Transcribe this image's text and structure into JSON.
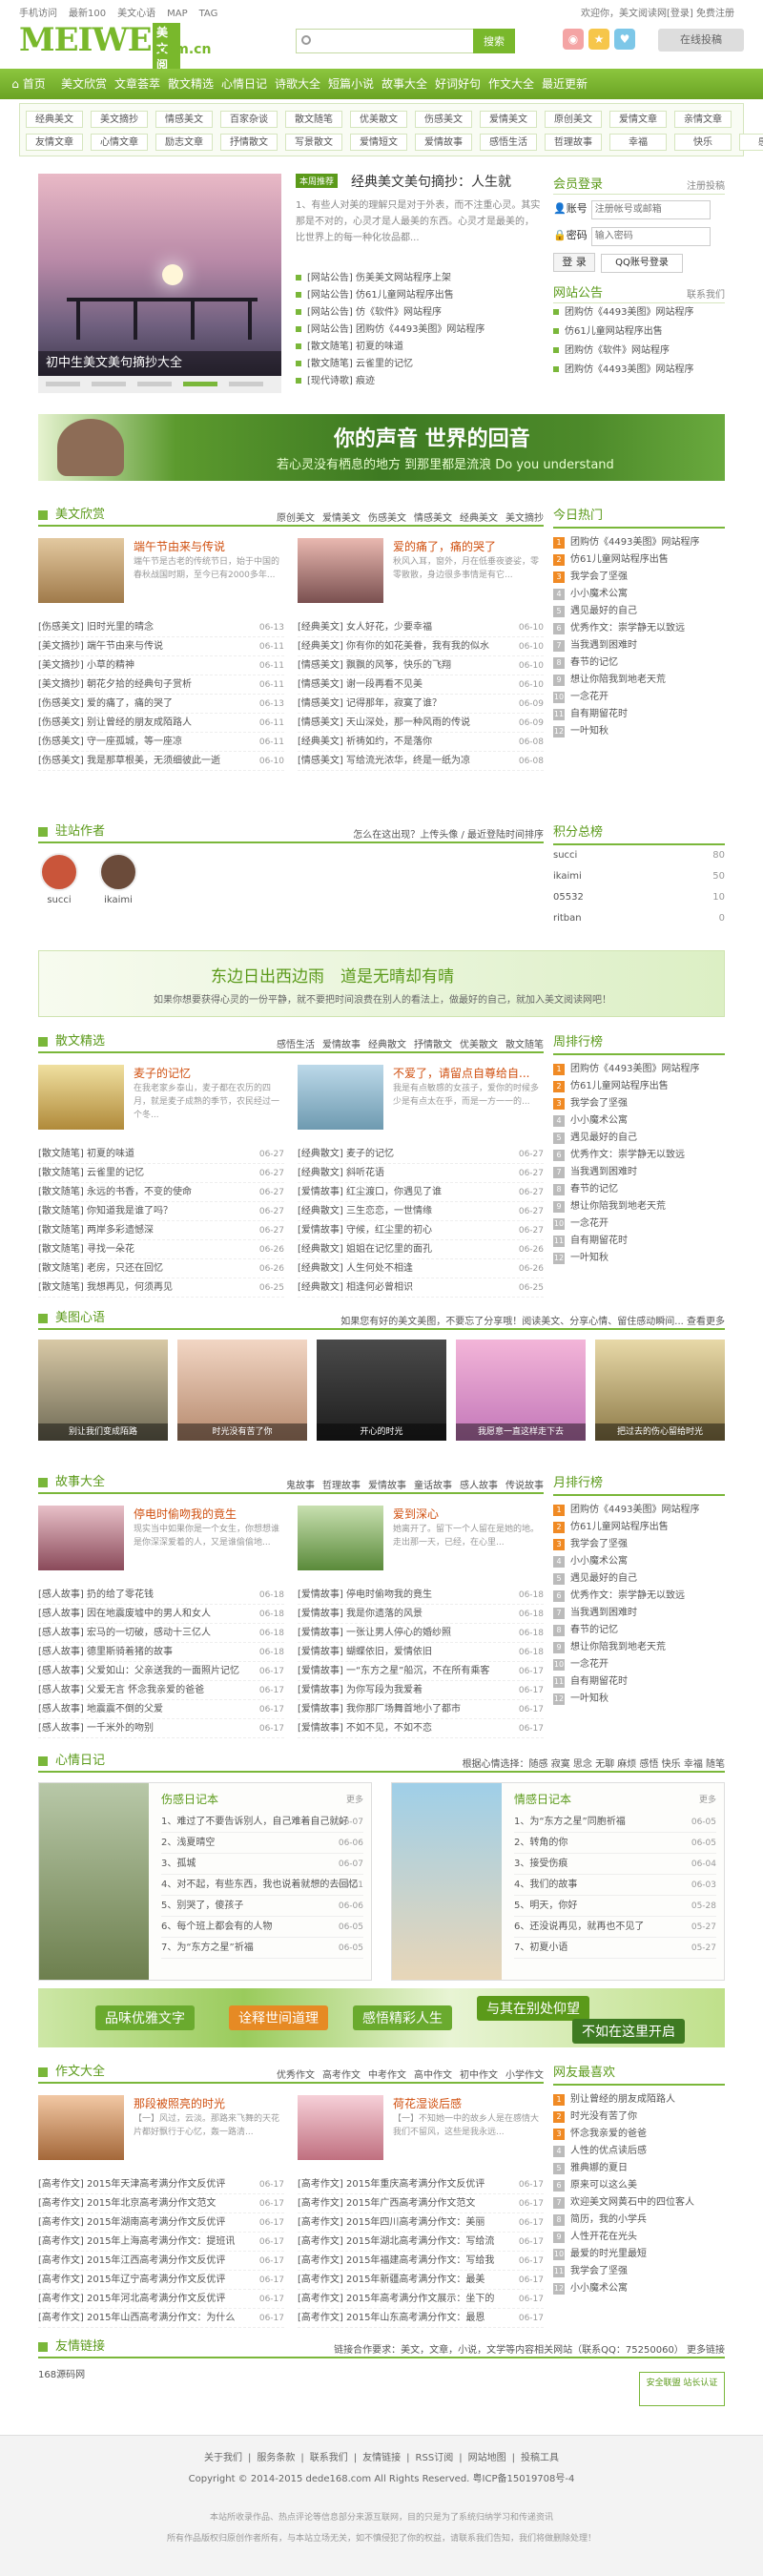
{
  "top": {
    "links": [
      "手机访问",
      "最新100",
      "美文心语",
      "MAP",
      "TAG"
    ],
    "welcome": "欢迎你，美文阅读网[登录] 免费注册"
  },
  "logo": {
    "main": "MEIWEN",
    "badge": "美文阅读",
    "domain": ".com.cn"
  },
  "search": {
    "placeholder": "",
    "button": "搜索"
  },
  "header": {
    "right_button": "在线投稿"
  },
  "nav": [
    "首页",
    "美文欣赏",
    "文章荟萃",
    "散文精选",
    "心情日记",
    "诗歌大全",
    "短篇小说",
    "故事大全",
    "好词好句",
    "作文大全",
    "最近更新"
  ],
  "subnav": [
    [
      "经典美文",
      "美文摘抄",
      "情感美文",
      "百家杂谈",
      "散文随笔",
      "优美散文",
      "伤感美文",
      "爱情美文",
      "原创美文",
      "爱情文章",
      "亲情文章"
    ],
    [
      "友情文章",
      "心情文章",
      "励志文章",
      "抒情散文",
      "写景散文",
      "爱情短文",
      "爱情故事",
      "感悟生活",
      "哲理故事",
      "幸福",
      "快乐",
      "感伤"
    ]
  ],
  "slide": {
    "caption": "初中生美文美句摘抄大全"
  },
  "headline": {
    "tag": "本周推荐",
    "title": "经典美文美句摘抄：人生就",
    "desc": "1、有些人对美的理解只是对于外表，而不注重心灵。其实那是不对的，心灵才是人最美的东西。心灵才是最美的，比世界上的每一种化妆品都...",
    "list": [
      "[网站公告] 伤美美文网站程序上架",
      "[网站公告] 仿61儿童网站程序出售",
      "[网站公告] 仿《软件》网站程序",
      "[网站公告] 团购仿《4493美图》网站程序",
      "[散文随笔] 初夏的味道",
      "[散文随笔] 云雀里的记忆",
      "[现代诗歌] 痕迹"
    ]
  },
  "login": {
    "title": "会员登录",
    "reg": "注册投稿",
    "user_label": "账号",
    "user_ph": "注册帐号或邮箱",
    "pwd_label": "密码",
    "pwd_ph": "输入密码",
    "btn": "登 录",
    "qq": "QQ账号登录"
  },
  "notice": {
    "title": "网站公告",
    "more": "联系我们",
    "list": [
      "团购仿《4493美图》网站程序",
      "仿61儿童网站程序出售",
      "团购仿《软件》网站程序",
      "团购仿《4493美图》网站程序"
    ]
  },
  "banner": {
    "t1": "你的声音 世界的回音",
    "t2": "若心灵没有栖息的地方 到那里都是流浪 Do you understand"
  },
  "sec1": {
    "title": "美文欣赏",
    "tabs": [
      "原创美文",
      "爱情美文",
      "伤感美文",
      "情感美文",
      "经典美文",
      "美文摘抄"
    ],
    "f1": {
      "title": "端午节由来与传说",
      "desc": "端午节是古老的传统节日，始于中国的春秋战国时期，至今已有2000多年..."
    },
    "f2": {
      "title": "爱的痛了，痛的哭了",
      "desc": "秋风入耳，窗外，月在低垂夜婆娑，零零散散，身边很多事情是有它..."
    },
    "l1": [
      [
        "[伤感美文] 旧时光里的晴念",
        "06-13"
      ],
      [
        "[美文摘抄] 端午节由来与传说",
        "06-11"
      ],
      [
        "[美文摘抄] 小草的精神",
        "06-11"
      ],
      [
        "[美文摘抄] 朝花夕拾的经典句子赏析",
        "06-11"
      ],
      [
        "[伤感美文] 爱的痛了，痛的哭了",
        "06-13"
      ],
      [
        "[伤感美文] 别让曾经的朋友成陌路人",
        "06-11"
      ],
      [
        "[伤感美文] 守一座孤城，等一座凉",
        "06-11"
      ],
      [
        "[伤感美文] 我是那草根美，无须细彼此一逝",
        "06-10"
      ]
    ],
    "l2": [
      [
        "[经典美文] 女人好花，少要幸福",
        "06-10"
      ],
      [
        "[经典美文] 你有你的如花美眷，我有我的似水",
        "06-10"
      ],
      [
        "[情感美文] 飘飘的风筝，快乐的飞翔",
        "06-10"
      ],
      [
        "[情感美文] 谢一段再看不见美",
        "06-10"
      ],
      [
        "[情感美文] 记得那年，寂寞了谁？",
        "06-09"
      ],
      [
        "[情感美文] 天山深处，那一种风雨的传说",
        "06-09"
      ],
      [
        "[经典美文] 祈祷如约，不是落你",
        "06-08"
      ],
      [
        "[情感美文] 写给流光浓华，终是一纸为凉",
        "06-08"
      ]
    ]
  },
  "hot": {
    "title": "今日热门",
    "list": [
      "团购仿《4493美图》网站程序",
      "仿61儿童网站程序出售",
      "我学会了坚强",
      "小小魔术公寓",
      "遇见最好的自己",
      "优秀作文：崇学静无以致远",
      "当我遇到困难时",
      "春节的记忆",
      "想让你陪我到地老天荒",
      "一念花开",
      "自有期留花时",
      "一叶知秋"
    ]
  },
  "authors": {
    "title": "驻站作者",
    "tip": "怎么在这出现？上传头像 / 最近登陆时间排序",
    "list": [
      "succi",
      "ikaimi"
    ]
  },
  "score": {
    "title": "积分总榜",
    "list": [
      [
        "succi",
        "80"
      ],
      [
        "ikaimi",
        "50"
      ],
      [
        "05532",
        "10"
      ],
      [
        "ritban",
        "0"
      ]
    ]
  },
  "banner2": {
    "t1": "东边日出西边雨　道是无晴却有晴",
    "t2": "如果你想要获得心灵的一份平静，就不要把时间浪费在别人的看法上，做最好的自己，就加入美文阅读网吧！"
  },
  "sec2": {
    "title": "散文精选",
    "tabs": [
      "感悟生活",
      "爱情故事",
      "经典散文",
      "抒情散文",
      "优美散文",
      "散文随笔"
    ],
    "f1": {
      "title": "麦子的记忆",
      "desc": "在我老家乡泰山，麦子都在农历的四月，就是麦子成熟的季节，农民经过一个冬..."
    },
    "f2": {
      "title": "不爱了，请留点自尊给自...",
      "desc": "我是有点敏感的女孩子，爱你的时候多少是有点太在乎，而是一方一一的..."
    },
    "l1": [
      [
        "[散文随笔] 初夏的味道",
        "06-27"
      ],
      [
        "[散文随笔] 云雀里的记忆",
        "06-27"
      ],
      [
        "[散文随笔] 永远的书香，不变的使命",
        "06-27"
      ],
      [
        "[散文随笔] 你知道我是谁了吗？",
        "06-27"
      ],
      [
        "[散文随笔] 两岸多彩遗憾深",
        "06-27"
      ],
      [
        "[散文随笔] 寻找一朵花",
        "06-26"
      ],
      [
        "[散文随笔] 老房，只还在回忆",
        "06-26"
      ],
      [
        "[散文随笔] 我想再见，何须再见",
        "06-25"
      ]
    ],
    "l2": [
      [
        "[经典散文] 麦子的记忆",
        "06-27"
      ],
      [
        "[经典散文] 斜听花语",
        "06-27"
      ],
      [
        "[爱情故事] 红尘渡口，你遇见了谁",
        "06-27"
      ],
      [
        "[经典散文] 三生恋恋，一世情缘",
        "06-27"
      ],
      [
        "[爱情故事] 守候，红尘里的初心",
        "06-27"
      ],
      [
        "[经典散文] 姐姐在记忆里的面孔",
        "06-26"
      ],
      [
        "[经典散文] 人生何处不相逢",
        "06-26"
      ],
      [
        "[经典散文] 相逢何必曾相识",
        "06-25"
      ]
    ]
  },
  "week": {
    "title": "周排行榜",
    "list": [
      "团购仿《4493美图》网站程序",
      "仿61儿童网站程序出售",
      "我学会了坚强",
      "小小魔术公寓",
      "遇见最好的自己",
      "优秀作文：崇学静无以致远",
      "当我遇到困难时",
      "春节的记忆",
      "想让你陪我到地老天荒",
      "一念花开",
      "自有期留花时",
      "一叶知秋"
    ]
  },
  "pics": {
    "title": "美图心语",
    "tip": "如果您有好的美文美图，不要忘了分享哦！阅读美文、分享心情、留住感动瞬间... 查看更多",
    "list": [
      "别让我们变成陌路",
      "时光没有苦了你",
      "开心的时光",
      "我愿意一直这样走下去",
      "把过去的伤心留给时光"
    ]
  },
  "sec3": {
    "title": "故事大全",
    "tabs": [
      "鬼故事",
      "哲理故事",
      "爱情故事",
      "童话故事",
      "感人故事",
      "传说故事"
    ],
    "f1": {
      "title": "停电时偷吻我的竟生",
      "desc": "现实当中如果你是一个女生，你想想谁是你深深爱着的人，又是谁偷偷地..."
    },
    "f2": {
      "title": "爱到深心",
      "desc": "她离开了。留下一个人留在是她的地。 走出那一天，已经，在心里..."
    },
    "l1": [
      [
        "[感人故事] 扔的给了零花钱",
        "06-18"
      ],
      [
        "[感人故事] 因在地震废墟中的男人和女人",
        "06-18"
      ],
      [
        "[感人故事] 宏马的一切破，感动十三亿人",
        "06-18"
      ],
      [
        "[感人故事] 德里斯骑着猪的故事",
        "06-18"
      ],
      [
        "[感人故事] 父爱如山：父亲送我的一面照片记忆",
        "06-17"
      ],
      [
        "[感人故事] 父爱无言 怀念我亲爱的爸爸",
        "06-17"
      ],
      [
        "[感人故事] 地震震不倒的父爱",
        "06-17"
      ],
      [
        "[感人故事] 一千米外的吻别",
        "06-17"
      ]
    ],
    "l2": [
      [
        "[爱情故事] 停电时偷吻我的竟生",
        "06-18"
      ],
      [
        "[爱情故事] 我是你遗落的风景",
        "06-18"
      ],
      [
        "[爱情故事] 一张让男人停心的婚纱照",
        "06-18"
      ],
      [
        "[爱情故事] 蝴蝶依旧，爱情依旧",
        "06-18"
      ],
      [
        "[爱情故事] 一“东方之星”船沉，不在所有乘客",
        "06-17"
      ],
      [
        "[爱情故事] 为你写段为我爱着",
        "06-17"
      ],
      [
        "[爱情故事] 我你那厂场舞首地小了都市",
        "06-17"
      ],
      [
        "[爱情故事] 不如不见，不如不恋",
        "06-17"
      ]
    ]
  },
  "month": {
    "title": "月排行榜",
    "list": [
      "团购仿《4493美图》网站程序",
      "仿61儿童网站程序出售",
      "我学会了坚强",
      "小小魔术公寓",
      "遇见最好的自己",
      "优秀作文：崇学静无以致远",
      "当我遇到困难时",
      "春节的记忆",
      "想让你陪我到地老天荒",
      "一念花开",
      "自有期留花时",
      "一叶知秋"
    ]
  },
  "diary": {
    "title": "心情日记",
    "tabs": "根据心情选择：随感 寂寞 思念 无聊 麻烦 感悟 快乐 幸福 随笔",
    "a": {
      "title": "伤感日记本",
      "more": "更多",
      "list": [
        [
          "1、难过了不要告诉别人，自己难着自己就好",
          "06-07"
        ],
        [
          "2、浅夏晴空",
          "06-06"
        ],
        [
          "3、孤城",
          "06-07"
        ],
        [
          "4、对不起，有些东西，我也说着就想的去回忆",
          "06-01"
        ],
        [
          "5、别哭了，傻孩子",
          "06-06"
        ],
        [
          "6、每个班上都会有的人物",
          "06-05"
        ],
        [
          "7、为“东方之星”祈福",
          "06-05"
        ]
      ]
    },
    "b": {
      "title": "情感日记本",
      "more": "更多",
      "list": [
        [
          "1、为“东方之星”同胞祈福",
          "06-05"
        ],
        [
          "2、转角的你",
          "06-05"
        ],
        [
          "3、接受伤痕",
          "06-04"
        ],
        [
          "4、我们的故事",
          "06-03"
        ],
        [
          "5、明天，你好",
          "05-28"
        ],
        [
          "6、还没说再见，就再也不见了",
          "05-27"
        ],
        [
          "7、初夏小语",
          "05-27"
        ]
      ]
    }
  },
  "banner3": {
    "a": "品味优雅文字",
    "b": "诠释世间道理",
    "c": "感悟精彩人生",
    "d": "与其在别处仰望",
    "e": "不如在这里开启"
  },
  "sec4": {
    "title": "作文大全",
    "tabs": [
      "优秀作文",
      "高考作文",
      "中考作文",
      "高中作文",
      "初中作文",
      "小学作文"
    ],
    "f1": {
      "title": "那段被照亮的时光",
      "desc": "【一】风过，云淡。那路来飞舞的天花片都好飘行于心忆，轰一路清..."
    },
    "f2": {
      "title": "荷花湿谈后感",
      "desc": "【一】不知她一中的故乡人是在感情大我们不留风，这些是我永远..."
    },
    "l1": [
      [
        "[高考作文] 2015年天津高考满分作文反优评",
        "06-17"
      ],
      [
        "[高考作文] 2015年北京高考满分作文范文",
        "06-17"
      ],
      [
        "[高考作文] 2015年湖南高考满分作文反优评",
        "06-17"
      ],
      [
        "[高考作文] 2015年上海高考满分作文：提班讯",
        "06-17"
      ],
      [
        "[高考作文] 2015年江西高考满分作文反优评",
        "06-17"
      ],
      [
        "[高考作文] 2015年辽宁高考满分作文反优评",
        "06-17"
      ],
      [
        "[高考作文] 2015年河北高考满分作文反优评",
        "06-17"
      ],
      [
        "[高考作文] 2015年山西高考满分作文：为什么",
        "06-17"
      ]
    ],
    "l2": [
      [
        "[高考作文] 2015年重庆高考满分作文反优评",
        "06-17"
      ],
      [
        "[高考作文] 2015年广西高考满分作文范文",
        "06-17"
      ],
      [
        "[高考作文] 2015年四川高考满分作文：美丽",
        "06-17"
      ],
      [
        "[高考作文] 2015年湖北高考满分作文：写给流",
        "06-17"
      ],
      [
        "[高考作文] 2015年福建高考满分作文：写给我",
        "06-17"
      ],
      [
        "[高考作文] 2015年新疆高考满分作文：最美",
        "06-17"
      ],
      [
        "[高考作文] 2015年高考满分作文展示：坐下的",
        "06-17"
      ],
      [
        "[高考作文] 2015年山东高考满分作文：最恩",
        "06-17"
      ]
    ]
  },
  "fav": {
    "title": "网友最喜欢",
    "list": [
      "别让曾经的朋友成陌路人",
      "时光没有苦了你",
      "怀念我亲爱的爸爸",
      "人性的优点读后感",
      "雅典娜的夏日",
      "原来可以这么美",
      "欢迎美文网黄石中的四位客人",
      "简历，我的小学兵",
      "人性开花在光头",
      "最爱的时光里最短",
      "我学会了坚强",
      "小小魔术公寓"
    ]
  },
  "flinks": {
    "title": "友情链接",
    "tip": "链接合作要求：美文，文章，小说，文学等内容相关网站（联系QQ：75250060） 更多链接",
    "items": [
      "168源码网"
    ],
    "badge": "安全联盟 站长认证"
  },
  "footer": {
    "links": [
      "关于我们",
      "服务条款",
      "联系我们",
      "友情链接",
      "RSS订阅",
      "网站地图",
      "投稿工具"
    ],
    "copy": "Copyright © 2014-2015 dede168.com All Rights Reserved. 粤ICP备15019708号-4",
    "n1": "本站所收录作品、热点评论等信息部分来源互联网，目的只是为了系统归纳学习和传递资讯",
    "n2": "所有作品版权归原创作者所有，与本站立场无关，如不慎侵犯了你的权益，请联系我们告知，我们将做删除处理！"
  }
}
